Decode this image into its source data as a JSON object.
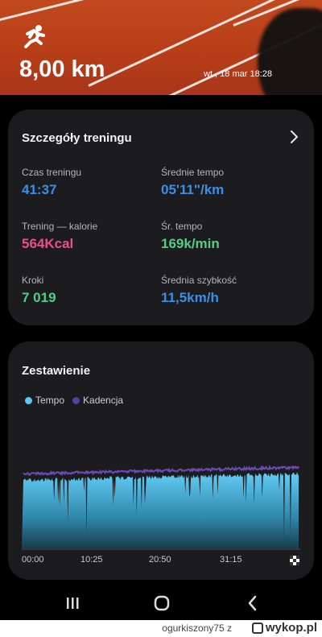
{
  "hero": {
    "distance": "8,00 km",
    "date": "wt., 18 mar 18:28",
    "icon": "running-person-icon"
  },
  "details": {
    "title": "Szczegóły treningu",
    "stats": [
      {
        "label": "Czas treningu",
        "value": "41:37",
        "color": "#3b8fe6"
      },
      {
        "label": "Średnie tempo",
        "value": "05'11\"/km",
        "color": "#3b8fe6"
      },
      {
        "label": "Trening — kalorie",
        "value": "564Kcal",
        "color": "#ec4f88"
      },
      {
        "label": "Śr. tempo",
        "value": "169k/min",
        "color": "#4fcf86"
      },
      {
        "label": "Kroki",
        "value": "7 019",
        "color": "#4fcf86"
      },
      {
        "label": "Średnia szybkość",
        "value": "11,5km/h",
        "color": "#3b8fe6"
      }
    ]
  },
  "summary": {
    "title": "Zestawienie",
    "legend": [
      {
        "name": "Tempo",
        "color": "#5bc8f5"
      },
      {
        "name": "Kadencja",
        "color": "#5a3ea0"
      }
    ]
  },
  "chart_data": {
    "type": "area",
    "x_ticks": [
      "00:00",
      "10:25",
      "20:50",
      "31:15"
    ],
    "series": [
      {
        "name": "Tempo",
        "color": "#5bc8f5"
      },
      {
        "name": "Kadencja",
        "color": "#5a3ea0"
      }
    ],
    "grid": false
  },
  "footer": {
    "user": "ogurkiszony75",
    "z": "z",
    "site": "wykop.pl"
  }
}
